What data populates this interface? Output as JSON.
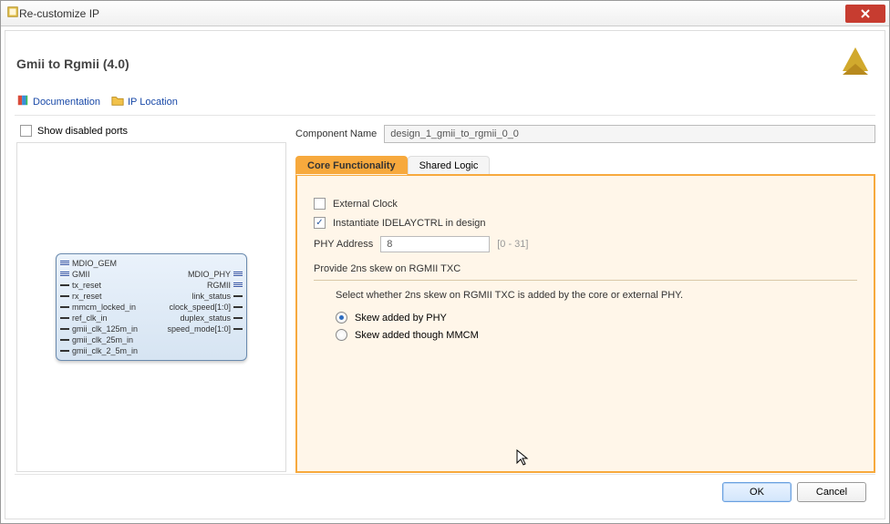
{
  "window": {
    "title": "Re-customize IP"
  },
  "heading": "Gmii to Rgmii (4.0)",
  "toolbar": {
    "documentation": "Documentation",
    "ip_location": "IP Location"
  },
  "left": {
    "show_disabled_label": "Show disabled ports",
    "ip_ports_left": [
      "MDIO_GEM",
      "GMII",
      "tx_reset",
      "rx_reset",
      "mmcm_locked_in",
      "ref_clk_in",
      "gmii_clk_125m_in",
      "gmii_clk_25m_in",
      "gmii_clk_2_5m_in"
    ],
    "ip_ports_right": [
      "MDIO_PHY",
      "RGMII",
      "link_status",
      "clock_speed[1:0]",
      "duplex_status",
      "speed_mode[1:0]"
    ]
  },
  "component_name_label": "Component Name",
  "component_name_value": "design_1_gmii_to_rgmii_0_0",
  "tabs": {
    "core": "Core Functionality",
    "shared": "Shared Logic"
  },
  "form": {
    "external_clock": "External Clock",
    "idelayctrl": "Instantiate IDELAYCTRL in design",
    "phy_addr_label": "PHY Address",
    "phy_addr_value": "8",
    "phy_addr_hint": "[0 - 31]",
    "skew_section": "Provide 2ns skew on RGMII TXC",
    "skew_desc": "Select whether 2ns skew on RGMII TXC is added by the core or external PHY.",
    "skew_opt_phy": "Skew added by PHY",
    "skew_opt_mmcm": "Skew added though MMCM"
  },
  "footer": {
    "ok": "OK",
    "cancel": "Cancel"
  }
}
